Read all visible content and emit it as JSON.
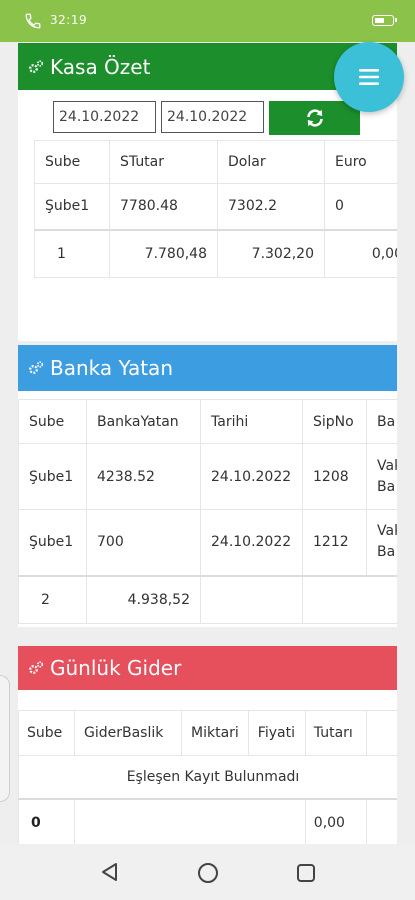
{
  "status": {
    "time": "32:19"
  },
  "kasa": {
    "title": "Kasa Özet",
    "date_from": "24.10.2022",
    "date_to": "24.10.2022",
    "columns": [
      "Sube",
      "STutar",
      "Dolar",
      "Euro"
    ],
    "rows": [
      [
        "Şube1",
        "7780.48",
        "7302.2",
        "0"
      ]
    ],
    "footer": [
      "1",
      "7.780,48",
      "7.302,20",
      "0,00"
    ]
  },
  "banka": {
    "title": "Banka Yatan",
    "columns": [
      "Sube",
      "BankaYatan",
      "Tarihi",
      "SipNo",
      "Ba"
    ],
    "rows": [
      [
        "Şube1",
        "4238.52",
        "24.10.2022",
        "1208",
        "Vak",
        "Ba"
      ],
      [
        "Şube1",
        "700",
        "24.10.2022",
        "1212",
        "Vak",
        "Ba"
      ]
    ],
    "footer": [
      "2",
      "4.938,52"
    ]
  },
  "gider": {
    "title": "Günlük Gider",
    "columns": [
      "Sube",
      "GiderBaslik",
      "Miktari",
      "Fiyati",
      "Tutarı"
    ],
    "empty_message": "Eşleşen Kayıt Bulunmadı",
    "footer": [
      "0",
      "0,00"
    ]
  }
}
